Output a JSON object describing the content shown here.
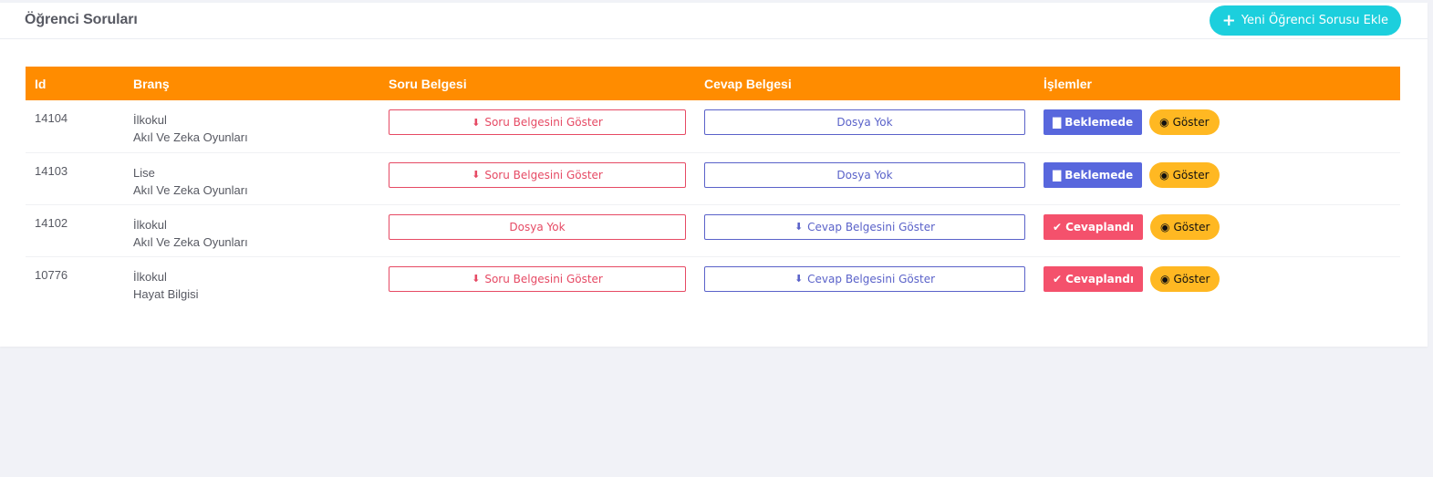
{
  "page": {
    "title": "Öğrenci Soruları",
    "add_button_label": "Yeni Öğrenci Sorusu Ekle"
  },
  "colors": {
    "table_header": "#ff8c00",
    "add_button": "#1ccfdd",
    "soru_border": "#e64a64",
    "cevap_border": "#5a62c9",
    "pending": "#5867dd",
    "answered": "#f4516c",
    "view": "#ffb822"
  },
  "table": {
    "headers": {
      "id": "Id",
      "brans": "Branş",
      "soru": "Soru Belgesi",
      "cevap": "Cevap Belgesi",
      "islemler": "İşlemler"
    },
    "rows": [
      {
        "id": "14104",
        "level": "İlkokul",
        "subject": "Akıl Ve Zeka Oyunları",
        "soru": "Soru Belgesini Göster",
        "cevap": "Dosya Yok",
        "status": "Beklemede",
        "view": "Göster"
      },
      {
        "id": "14103",
        "level": "Lise",
        "subject": "Akıl Ve Zeka Oyunları",
        "soru": "Soru Belgesini Göster",
        "cevap": "Dosya Yok",
        "status": "Beklemede",
        "view": "Göster"
      },
      {
        "id": "14102",
        "level": "İlkokul",
        "subject": "Akıl Ve Zeka Oyunları",
        "soru": "Dosya Yok",
        "cevap": "Cevap Belgesini Göster",
        "status": "Cevaplandı",
        "view": "Göster"
      },
      {
        "id": "10776",
        "level": "İlkokul",
        "subject": "Hayat Bilgisi",
        "soru": "Soru Belgesini Göster",
        "cevap": "Cevap Belgesini Göster",
        "status": "Cevaplandı",
        "view": "Göster"
      }
    ]
  },
  "icons": {
    "add": "plus-icon",
    "download": "download-icon",
    "pending": "archive-icon",
    "answered": "check-circle-icon",
    "view": "eye-icon"
  }
}
